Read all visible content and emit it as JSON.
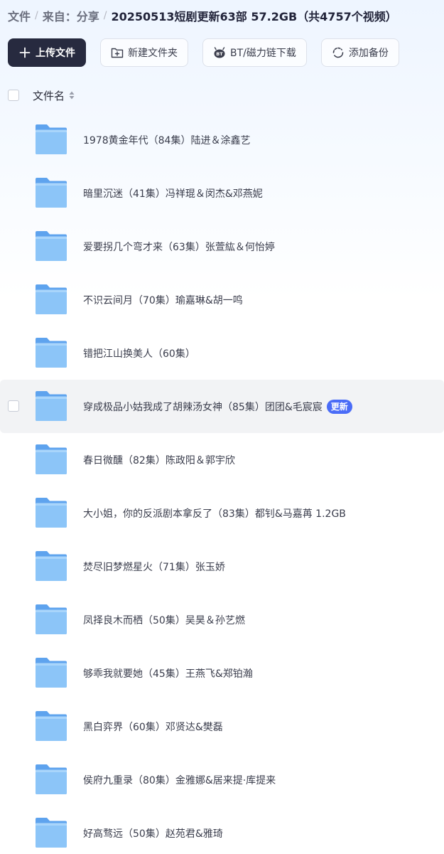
{
  "breadcrumb": {
    "root": "文件",
    "source": "来自：分享",
    "current": "20250513短剧更新63部 57.2GB（共4757个视频）"
  },
  "toolbar": {
    "upload_label": "上传文件",
    "new_folder_label": "新建文件夹",
    "bt_label": "BT/磁力链下载",
    "backup_label": "添加备份"
  },
  "list_header": {
    "name_label": "文件名"
  },
  "files": [
    {
      "name": "1978黄金年代（84集）陆进＆涂鑫艺"
    },
    {
      "name": "暗里沉迷（41集）冯祥琨＆闵杰&邓燕妮"
    },
    {
      "name": "爱要拐几个弯才来（63集）张萱紘＆何怡婷"
    },
    {
      "name": "不识云间月（70集）瑜嘉琳&胡一鸣"
    },
    {
      "name": "错把江山换美人（60集）"
    },
    {
      "name": "穿成极品小姑我成了胡辣汤女神（85集）团团&毛宸宸",
      "badge": "更新"
    },
    {
      "name": "春日微醺（82集）陈政阳＆郭宇欣"
    },
    {
      "name": "大小姐，你的反派剧本拿反了（83集）都钊&马嘉苒 1.2GB"
    },
    {
      "name": "焚尽旧梦燃星火（71集）张玉娇"
    },
    {
      "name": "凤择良木而栖（50集）吴昊＆孙艺燃"
    },
    {
      "name": "够乖我就要她（45集）王燕飞&郑铂瀚"
    },
    {
      "name": "黑白弈界（60集）邓贤达&樊磊"
    },
    {
      "name": "侯府九重录（80集）金雅娜&居来提·库提来"
    },
    {
      "name": "好高骛远（50集）赵苑君&雅琦"
    }
  ],
  "icons": {
    "folder": "folder-icon",
    "upload": "plus-icon",
    "new_folder": "folder-plus-icon",
    "bt": "bt-magnet-icon",
    "backup": "sync-icon",
    "sort": "sort-icon"
  },
  "colors": {
    "primary_button": "#272a3f",
    "badge": "#4a6cf7",
    "folder": "#6fb1f5"
  }
}
